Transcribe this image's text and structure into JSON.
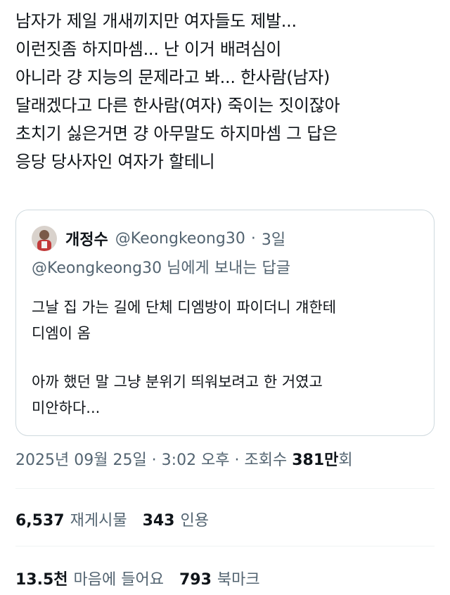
{
  "tweet": {
    "lines": [
      "남자가 제일 개새끼지만 여자들도 제발...",
      "이런짓좀 하지마셈... 난 이거 배려심이",
      "아니라 걍 지능의 문제라고 봐... 한사람(남자)",
      "달래겠다고 다른 한사람(여자) 죽이는 짓이잖아",
      "초치기 싫은거면 걍 아무말도 하지마셈 그 답은",
      "응당 당사자인 여자가 할테니"
    ]
  },
  "quote": {
    "name": "개정수",
    "handle": "@Keongkeong30",
    "separator": "·",
    "time": "3일",
    "reply_to": "@Keongkeong30 님에게 보내는 답글",
    "paragraph1": [
      "그날 집 가는 길에 단체 디엠방이 파이더니 걔한테",
      "디엠이 옴"
    ],
    "paragraph2": [
      "아까 했던 말 그냥 분위기 띄워보려고 한 거였고",
      "미안하다..."
    ]
  },
  "meta": {
    "datetime": "2025년 09월 25일 · 3:02 오후 · 조회수 ",
    "views_number": "381만",
    "views_suffix": "회"
  },
  "stats": {
    "retweets_count": "6,537",
    "retweets_label": "재게시물",
    "quotes_count": "343",
    "quotes_label": "인용",
    "likes_count": "13.5천",
    "likes_label": "마음에 들어요",
    "bookmarks_count": "793",
    "bookmarks_label": "북마크"
  },
  "colors": {
    "text_primary": "#0f1419",
    "text_secondary": "#536471",
    "border": "#cfd9de",
    "divider": "#eff3f4"
  }
}
